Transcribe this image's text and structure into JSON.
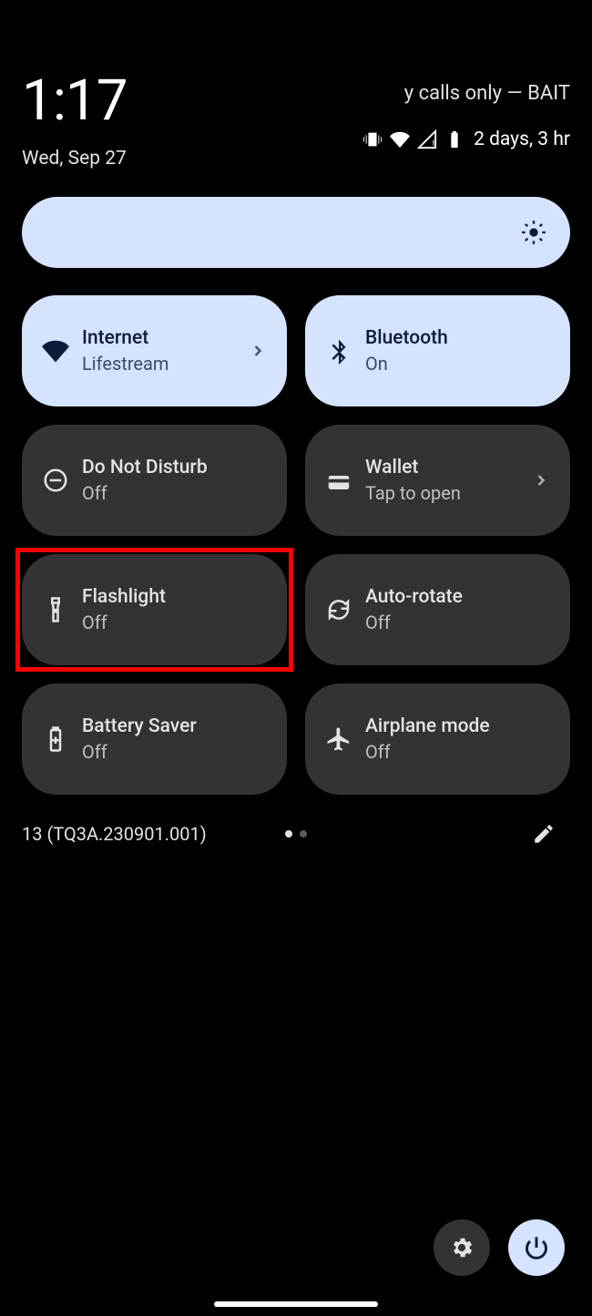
{
  "header": {
    "time": "1:17",
    "date": "Wed, Sep 27",
    "carrier": "y calls only — BAIT",
    "battery_text": "2 days, 3 hr"
  },
  "tiles": [
    {
      "id": "internet",
      "title": "Internet",
      "sub": "Lifestream",
      "active": true,
      "chevron": true
    },
    {
      "id": "bluetooth",
      "title": "Bluetooth",
      "sub": "On",
      "active": true,
      "chevron": false
    },
    {
      "id": "dnd",
      "title": "Do Not Disturb",
      "sub": "Off",
      "active": false,
      "chevron": false
    },
    {
      "id": "wallet",
      "title": "Wallet",
      "sub": "Tap to open",
      "active": false,
      "chevron": true
    },
    {
      "id": "flashlight",
      "title": "Flashlight",
      "sub": "Off",
      "active": false,
      "highlighted": true,
      "chevron": false
    },
    {
      "id": "autorotate",
      "title": "Auto-rotate",
      "sub": "Off",
      "active": false,
      "chevron": false
    },
    {
      "id": "batterysaver",
      "title": "Battery Saver",
      "sub": "Off",
      "active": false,
      "chevron": false
    },
    {
      "id": "airplane",
      "title": "Airplane mode",
      "sub": "Off",
      "active": false,
      "chevron": false
    }
  ],
  "footer": {
    "build": "13 (TQ3A.230901.001)",
    "page": 1,
    "total_pages": 2
  }
}
